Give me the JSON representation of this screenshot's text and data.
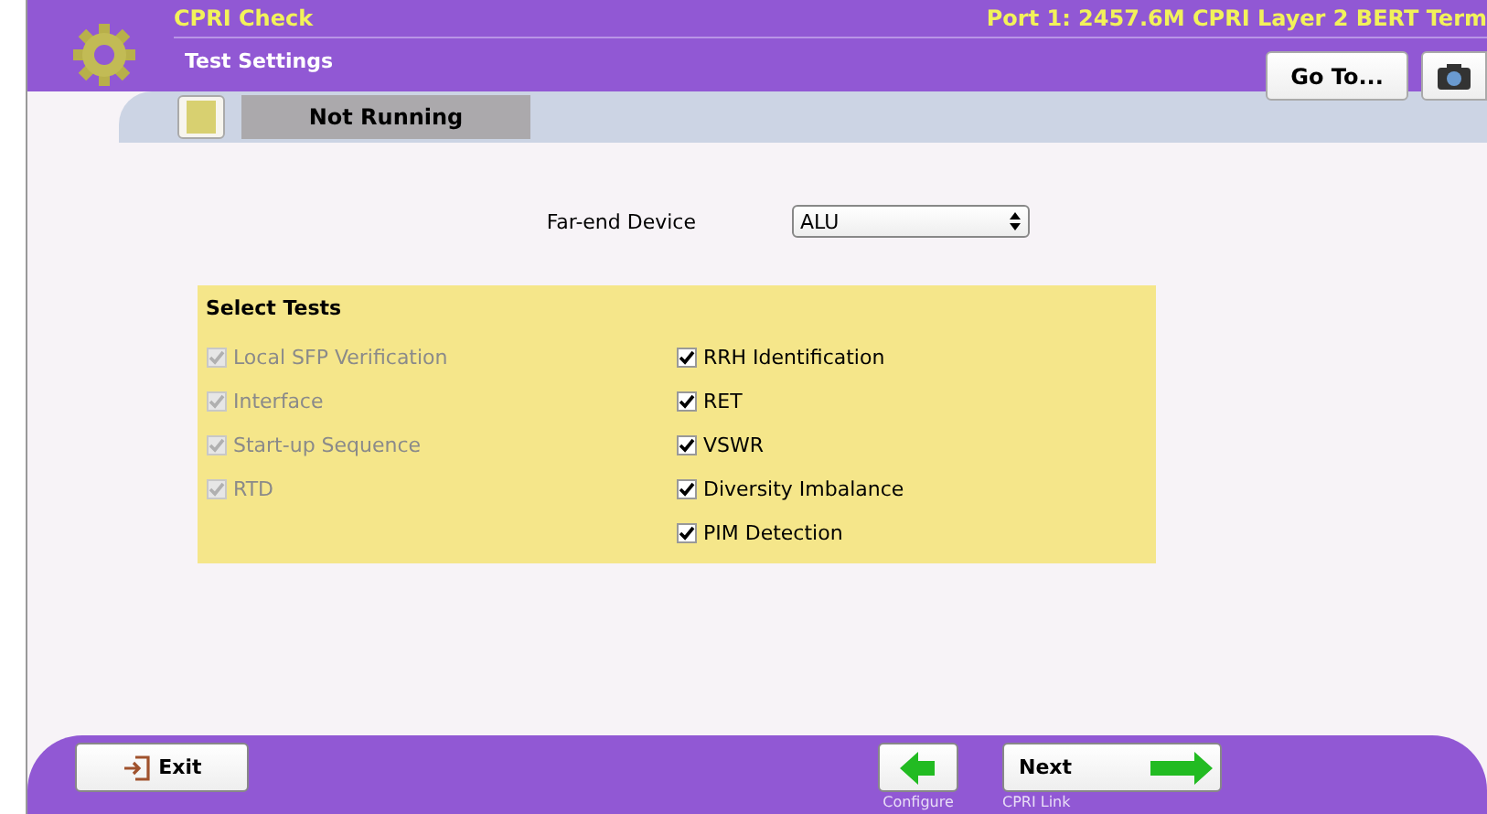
{
  "header": {
    "app_title": "CPRI Check",
    "subtitle": "Test Settings",
    "port_info": "Port 1: 2457.6M CPRI Layer 2 BERT Term",
    "goto_button": "Go To..."
  },
  "status": {
    "text": "Not Running"
  },
  "far_end": {
    "label": "Far-end Device",
    "value": "ALU"
  },
  "select_tests": {
    "title": "Select Tests",
    "left": [
      {
        "label": "Local SFP Verification",
        "checked": true,
        "disabled": true
      },
      {
        "label": "Interface",
        "checked": true,
        "disabled": true
      },
      {
        "label": "Start-up Sequence",
        "checked": true,
        "disabled": true
      },
      {
        "label": "RTD",
        "checked": true,
        "disabled": true
      }
    ],
    "right": [
      {
        "label": "RRH Identification",
        "checked": true,
        "disabled": false
      },
      {
        "label": "RET",
        "checked": true,
        "disabled": false
      },
      {
        "label": "VSWR",
        "checked": true,
        "disabled": false
      },
      {
        "label": "Diversity Imbalance",
        "checked": true,
        "disabled": false
      },
      {
        "label": "PIM Detection",
        "checked": true,
        "disabled": false
      }
    ]
  },
  "footer": {
    "exit": "Exit",
    "back_caption": "Configure",
    "next": "Next",
    "next_caption": "CPRI Link"
  }
}
